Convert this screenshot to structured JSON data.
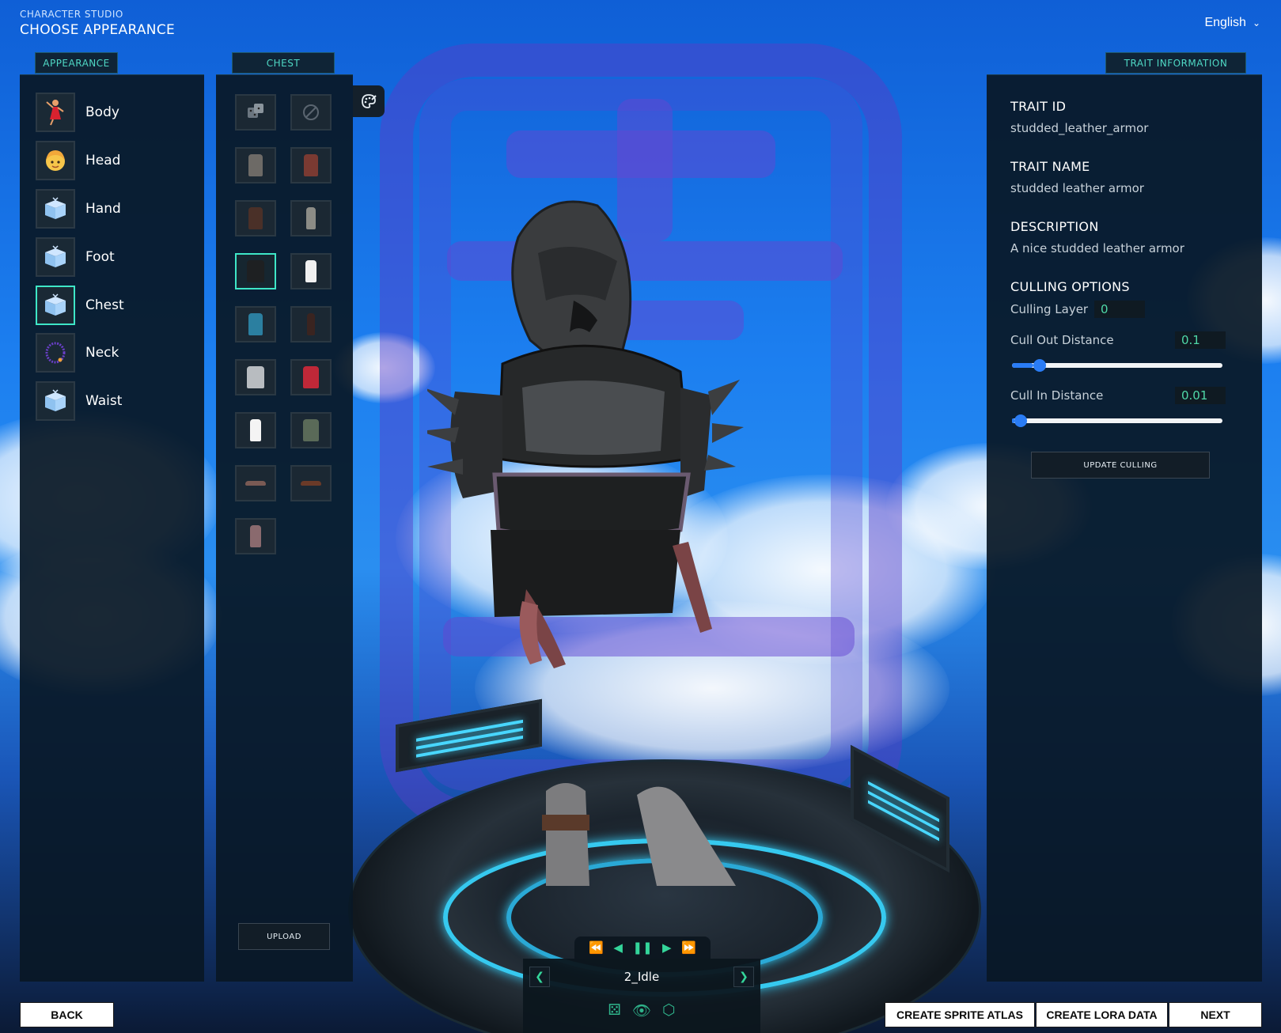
{
  "header": {
    "subtitle": "CHARACTER STUDIO",
    "title": "CHOOSE APPEARANCE",
    "language": "English"
  },
  "appearance": {
    "tab_label": "APPEARANCE",
    "items": [
      {
        "label": "Body",
        "icon": "dancer-icon"
      },
      {
        "label": "Head",
        "icon": "face-icon"
      },
      {
        "label": "Hand",
        "icon": "box-icon"
      },
      {
        "label": "Foot",
        "icon": "box-icon"
      },
      {
        "label": "Chest",
        "icon": "box-icon",
        "selected": true
      },
      {
        "label": "Neck",
        "icon": "necklace-icon"
      },
      {
        "label": "Waist",
        "icon": "box-icon"
      }
    ]
  },
  "chest": {
    "tab_label": "CHEST",
    "upload_label": "UPLOAD"
  },
  "trait": {
    "tab_label": "TRAIT INFORMATION",
    "id_heading": "TRAIT ID",
    "id_value": "studded_leather_armor",
    "name_heading": "TRAIT NAME",
    "name_value": "studded leather armor",
    "description_heading": "DESCRIPTION",
    "description_value": "A nice studded leather armor",
    "culling_heading": "CULLING OPTIONS",
    "culling_layer_label": "Culling Layer",
    "culling_layer_value": "0",
    "cull_out_label": "Cull Out Distance",
    "cull_out_value": "0.1",
    "cull_out_level": 0.1,
    "cull_in_label": "Cull In Distance",
    "cull_in_value": "0.01",
    "cull_in_level": 0.01,
    "update_label": "UPDATE CULLING"
  },
  "animation": {
    "name": "2_Idle"
  },
  "footer": {
    "back": "BACK",
    "sprite_atlas": "CREATE SPRITE ATLAS",
    "lora": "CREATE LORA DATA",
    "next": "NEXT"
  },
  "colors": {
    "accent": "#3ee6c7",
    "slider": "#2a7cf5",
    "panel": "#091826"
  }
}
